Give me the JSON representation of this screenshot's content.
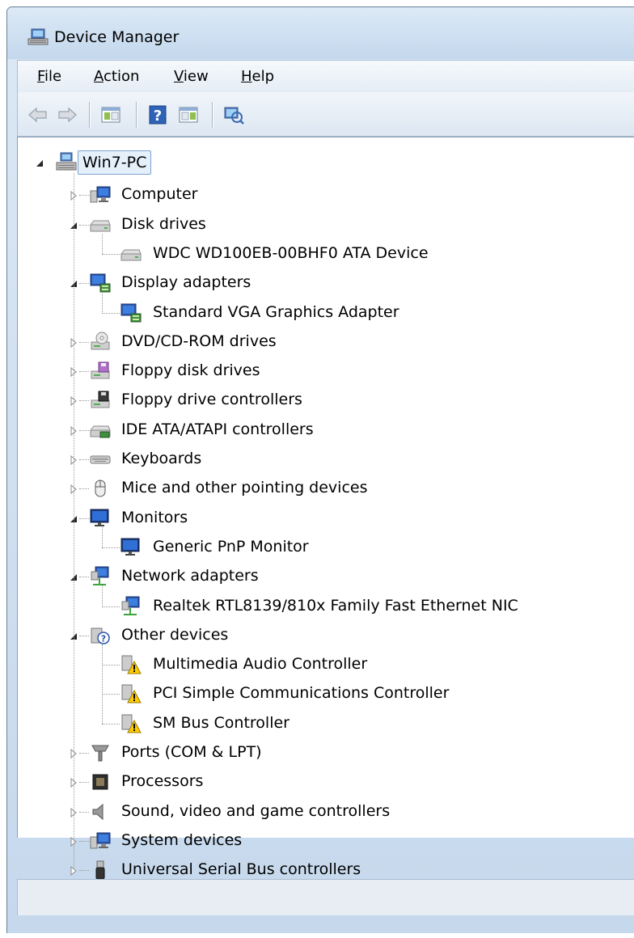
{
  "window": {
    "title": "Device Manager"
  },
  "menubar": {
    "items": [
      {
        "label": "File",
        "accel": "F",
        "rest": "ile"
      },
      {
        "label": "Action",
        "accel": "A",
        "rest": "ction"
      },
      {
        "label": "View",
        "accel": "V",
        "rest": "iew"
      },
      {
        "label": "Help",
        "accel": "H",
        "rest": "elp"
      }
    ]
  },
  "toolbar": {
    "buttons": [
      "back-icon",
      "forward-icon",
      "properties-pane-icon",
      "help-icon",
      "show-hide-tree-icon",
      "scan-hardware-icon"
    ]
  },
  "tree": {
    "root": {
      "label": "Win7-PC",
      "icon": "computer-network-icon",
      "expanded": true
    },
    "categories": [
      {
        "label": "Computer",
        "icon": "computer-icon",
        "expanded": false
      },
      {
        "label": "Disk drives",
        "icon": "disk-drive-icon",
        "expanded": true,
        "children": [
          {
            "label": "WDC WD100EB-00BHF0 ATA Device",
            "icon": "disk-drive-icon"
          }
        ]
      },
      {
        "label": "Display adapters",
        "icon": "display-adapter-icon",
        "expanded": true,
        "children": [
          {
            "label": "Standard VGA Graphics Adapter",
            "icon": "display-adapter-icon"
          }
        ]
      },
      {
        "label": "DVD/CD-ROM drives",
        "icon": "dvd-drive-icon",
        "expanded": false
      },
      {
        "label": "Floppy disk drives",
        "icon": "floppy-drive-icon",
        "expanded": false
      },
      {
        "label": "Floppy drive controllers",
        "icon": "floppy-controller-icon",
        "expanded": false
      },
      {
        "label": "IDE ATA/ATAPI controllers",
        "icon": "ide-controller-icon",
        "expanded": false
      },
      {
        "label": "Keyboards",
        "icon": "keyboard-icon",
        "expanded": false
      },
      {
        "label": "Mice and other pointing devices",
        "icon": "mouse-icon",
        "expanded": false
      },
      {
        "label": "Monitors",
        "icon": "monitor-icon",
        "expanded": true,
        "children": [
          {
            "label": "Generic PnP Monitor",
            "icon": "monitor-icon"
          }
        ]
      },
      {
        "label": "Network adapters",
        "icon": "network-adapter-icon",
        "expanded": true,
        "children": [
          {
            "label": "Realtek RTL8139/810x Family Fast Ethernet NIC",
            "icon": "network-adapter-icon"
          }
        ]
      },
      {
        "label": "Other devices",
        "icon": "unknown-device-icon",
        "expanded": true,
        "children": [
          {
            "label": "Multimedia Audio Controller",
            "icon": "warning-device-icon"
          },
          {
            "label": "PCI Simple Communications Controller",
            "icon": "warning-device-icon"
          },
          {
            "label": "SM Bus Controller",
            "icon": "warning-device-icon"
          }
        ]
      },
      {
        "label": "Ports (COM & LPT)",
        "icon": "port-icon",
        "expanded": false
      },
      {
        "label": "Processors",
        "icon": "processor-icon",
        "expanded": false
      },
      {
        "label": "Sound, video and game controllers",
        "icon": "sound-icon",
        "expanded": false
      },
      {
        "label": "System devices",
        "icon": "system-device-icon",
        "expanded": false
      },
      {
        "label": "Universal Serial Bus controllers",
        "icon": "usb-icon",
        "expanded": false
      }
    ]
  },
  "statusbar": {
    "text": ""
  },
  "colors": {
    "selection_border": "#7da2ce",
    "selection_fill": "#e5f0fb",
    "chrome": "#cddff1"
  }
}
